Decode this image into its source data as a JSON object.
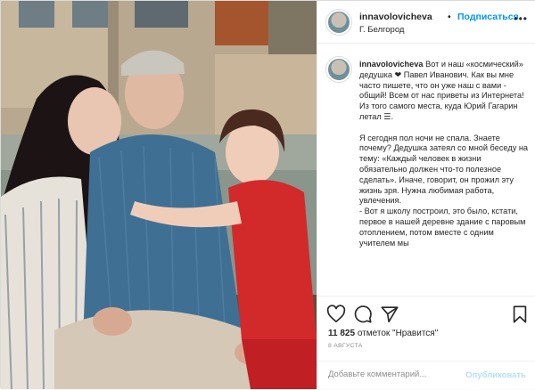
{
  "header": {
    "username": "innavolovicheva",
    "separator": "•",
    "follow_label": "Подписаться",
    "location": "Г. Белгород",
    "more_glyph": "•••"
  },
  "caption": {
    "username": "innavolovicheva",
    "paragraph1": "Вот и наш «космический» дедушка ❤ Павел Иванович. Как вы мне часто пишете, что он уже наш с вами - общий! Всем от нас приветы из Интернета! Из того самого места, куда Юрий Гагарин летал ☰.",
    "paragraph2": "Я сегодня пол ночи не спала. Знаете почему? Дедушка затеял со мной беседу на тему: «Каждый человек в жизни обязательно должен что-то полезное сделать». Иначе, говорит, он прожил эту жизнь зря. Нужна любимая работа, увлечения.",
    "paragraph3": "- Вот я школу построил, это было, кстати, первое в нашей деревне здание с паровым отоплением, потом вместе с одним учителем мы"
  },
  "actions": {
    "icons": [
      "heart-icon",
      "comment-icon",
      "share-icon",
      "bookmark-icon"
    ],
    "likes_count": "11 825",
    "likes_label": "отметок \"Нравится\"",
    "date": "8 августа"
  },
  "comment": {
    "placeholder": "Добавьте комментарий...",
    "publish_label": "Опубликовать"
  },
  "colors": {
    "link_blue": "#0095f6",
    "publish_disabled": "#b2dffc",
    "muted": "#8e8e8e",
    "border": "#efefef"
  }
}
